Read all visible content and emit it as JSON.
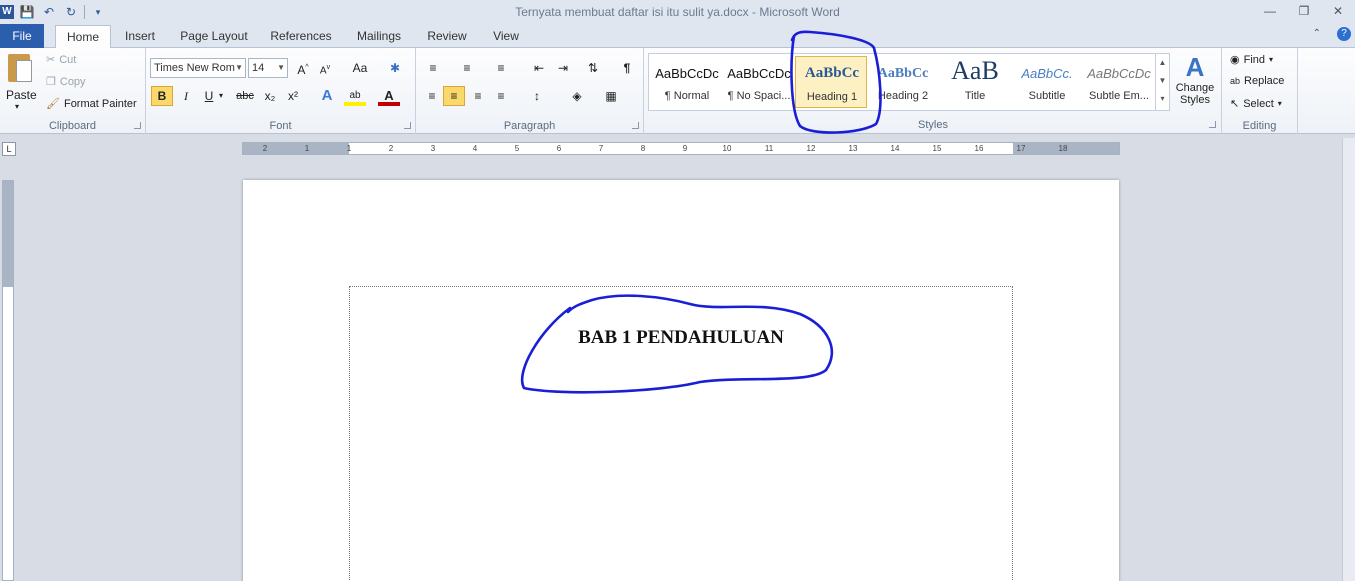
{
  "window": {
    "title": "Ternyata membuat daftar isi itu sulit ya.docx  -  Microsoft Word",
    "app_icon": "W"
  },
  "tabs": [
    {
      "label": "File"
    },
    {
      "label": "Home"
    },
    {
      "label": "Insert"
    },
    {
      "label": "Page Layout"
    },
    {
      "label": "References"
    },
    {
      "label": "Mailings"
    },
    {
      "label": "Review"
    },
    {
      "label": "View"
    }
  ],
  "clipboard": {
    "paste": "Paste",
    "cut": "Cut",
    "copy": "Copy",
    "format_painter": "Format Painter",
    "group_label": "Clipboard"
  },
  "font": {
    "font_name": "Times New Rom",
    "font_size": "14",
    "group_label": "Font",
    "bold": "B",
    "italic": "I",
    "underline": "U",
    "strike": "abc",
    "subscript": "x₂",
    "superscript": "x²",
    "grow": "A˄",
    "shrink": "A˅",
    "change_case": "Aa"
  },
  "paragraph": {
    "group_label": "Paragraph"
  },
  "styles": {
    "group_label": "Styles",
    "items": [
      {
        "preview": "AaBbCcDc",
        "name": "¶ Normal"
      },
      {
        "preview": "AaBbCcDc",
        "name": "¶ No Spaci..."
      },
      {
        "preview": "AaBbCc",
        "name": "Heading 1"
      },
      {
        "preview": "AaBbCc",
        "name": "Heading 2"
      },
      {
        "preview": "AaB",
        "name": "Title"
      },
      {
        "preview": "AaBbCc.",
        "name": "Subtitle"
      },
      {
        "preview": "AaBbCcDc",
        "name": "Subtle Em..."
      }
    ],
    "change_styles": "Change Styles"
  },
  "editing": {
    "group_label": "Editing",
    "find": "Find",
    "replace": "Replace",
    "select": "Select"
  },
  "ruler": {
    "labels": [
      "2",
      "1",
      "1",
      "2",
      "3",
      "4",
      "5",
      "6",
      "7",
      "8",
      "9",
      "10",
      "11",
      "12",
      "13",
      "14",
      "15",
      "16",
      "17",
      "18"
    ]
  },
  "document": {
    "heading": "BAB 1 PENDAHULUAN"
  },
  "annotation_color": "#1a1fd6"
}
